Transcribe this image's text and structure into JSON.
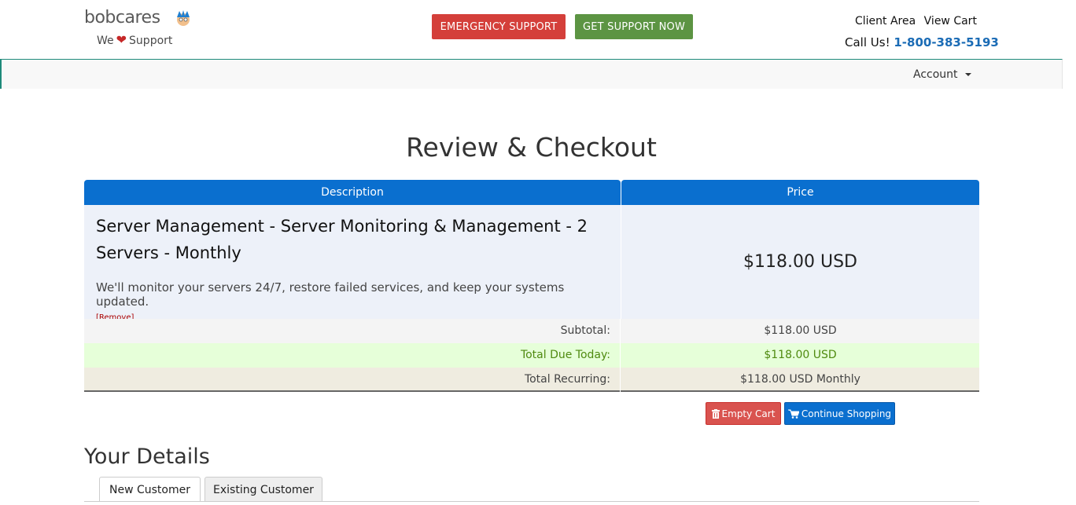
{
  "header": {
    "logo_text": "bobcares",
    "tagline_pre": "We",
    "tagline_post": "Support",
    "emergency_label": "EMERGENCY SUPPORT",
    "get_support_label": "GET SUPPORT NOW",
    "client_area": "Client Area",
    "view_cart": "View Cart",
    "call_us": "Call Us!",
    "phone": "1-800-383-5193"
  },
  "nav": {
    "account_label": "Account"
  },
  "page": {
    "title": "Review & Checkout"
  },
  "table": {
    "headers": {
      "description": "Description",
      "price": "Price"
    },
    "item": {
      "name": "Server Management - Server Monitoring & Management - 2 Servers - Monthly",
      "blurb": "We'll monitor your servers 24/7, restore failed services, and keep your systems updated.",
      "remove": "[Remove]",
      "price": "$118.00 USD"
    },
    "subtotal": {
      "label": "Subtotal:",
      "value": "$118.00 USD"
    },
    "total_due": {
      "label": "Total Due Today:",
      "value": "$118.00 USD"
    },
    "recurring": {
      "label": "Total Recurring:",
      "value": "$118.00 USD Monthly"
    }
  },
  "actions": {
    "empty_cart": "Empty Cart",
    "continue_shopping": "Continue Shopping"
  },
  "details": {
    "title": "Your Details",
    "tabs": [
      "New Customer",
      "Existing Customer"
    ]
  },
  "colors": {
    "primary": "#0a6fcf",
    "emergency": "#d43f3a",
    "support": "#5c9443",
    "due_text": "#4f8a10"
  },
  "icons": [
    "mascot-icon",
    "heart-icon",
    "caret-down-icon",
    "trash-icon",
    "cart-icon"
  ]
}
